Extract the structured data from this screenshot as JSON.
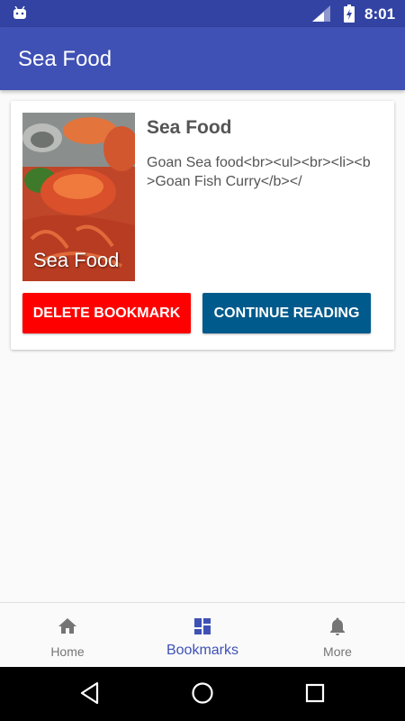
{
  "status_bar": {
    "time": "8:01"
  },
  "app_bar": {
    "title": "Sea Food"
  },
  "card": {
    "image_caption": "Sea Food",
    "title": "Sea Food",
    "description": "Goan Sea food<br><ul><br><li><b>Goan Fish Curry</b></",
    "delete_label": "DELETE BOOKMARK",
    "continue_label": "CONTINUE READING"
  },
  "bottom_nav": {
    "items": [
      {
        "label": "Home",
        "icon": "home-icon"
      },
      {
        "label": "Bookmarks",
        "icon": "dashboard-icon",
        "active": true
      },
      {
        "label": "More",
        "icon": "bell-icon"
      }
    ]
  },
  "colors": {
    "primary": "#3f51b5",
    "primary_dark": "#3343a3",
    "delete": "#ff0000",
    "continue": "#005a8c"
  }
}
